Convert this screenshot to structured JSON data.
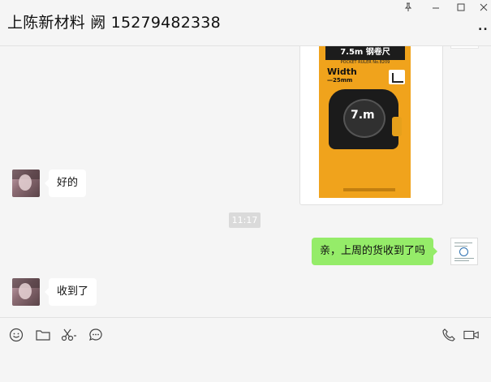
{
  "header": {
    "title": "上陈新材料 阙 15279482338",
    "more_label": ".."
  },
  "icons": {
    "pin": "pin-icon",
    "minimize": "minimize-icon",
    "maximize": "maximize-icon",
    "close": "close-icon",
    "more": "more-icon",
    "emoji": "emoji-icon",
    "folder": "folder-icon",
    "scissors": "scissors-icon",
    "chat_history": "chat-history-icon",
    "voice_call": "phone-icon",
    "video_call": "video-icon"
  },
  "product_image": {
    "brand": "7.5m 钢卷尺",
    "sub": "POCKET RULER No.8209",
    "width_label": "Width",
    "width_value": "—25mm",
    "big_label": "7.m"
  },
  "messages": [
    {
      "from": "contact",
      "text": "好的"
    },
    {
      "type": "time",
      "text": "11:17"
    },
    {
      "from": "me",
      "text": "亲，上周的货收到了吗"
    },
    {
      "from": "contact",
      "text": "收到了"
    }
  ],
  "colors": {
    "outgoing_bubble": "#95ec69",
    "incoming_bubble": "#ffffff",
    "background": "#f5f5f5"
  }
}
